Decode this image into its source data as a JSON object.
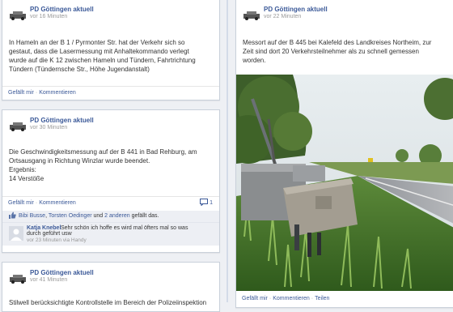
{
  "posts": [
    {
      "author": "PD Göttingen aktuell",
      "time": "vor 16 Minuten",
      "text": "In Hameln an der B 1 / Pyrmonter Str. hat der Verkehr sich so\ngestaut, dass die Lasermessung mit Anhaltekommando verlegt\nwurde auf die K 12 zwischen Hameln und Tündern, Fahrtrichtung\nTündern (Tündernsche Str., Höhe Jugendanstalt)",
      "like": "Gefällt mir",
      "comment": "Kommentieren"
    },
    {
      "author": "PD Göttingen aktuell",
      "time": "vor 30 Minuten",
      "text": "Die Geschwindigkeitsmessung auf der B 441 in Bad Rehburg, am\nOrtsausgang in Richtung Winzlar wurde beendet.\nErgebnis:\n14 Verstöße",
      "like": "Gefällt mir",
      "comment": "Kommentieren",
      "comment_count": "1",
      "likes": {
        "name1": "Bibi Busse",
        "name2": "Torsten Oedinger",
        "connector": "und",
        "others": "2 anderen",
        "suffix": "gefällt das."
      },
      "reply": {
        "author": "Katja Knebel",
        "text1": "Sehr schön ich hoffe es wird mal öfters mal so was",
        "text2": "durch geführt usw",
        "time": "vor 23 Minuten via Handy"
      }
    },
    {
      "author": "PD Göttingen aktuell",
      "time": "vor 41 Minuten",
      "text": "Stilwell berücksichtigte Kontrollstelle im Bereich der Polizeiinspektion"
    },
    {
      "author": "PD Göttingen aktuell",
      "time": "vor 22 Minuten",
      "text": "Messort auf der B 445 bei Kalefeld des Landkreises Northeim, zur\nZeit sind dort 20 Verkehrsteilnehmer als zu schnell gemessen\nworden.",
      "like": "Gefällt mir",
      "comment": "Kommentieren",
      "share": "Teilen"
    }
  ],
  "colors": {
    "link": "#3b5998",
    "meta": "#999999",
    "background": "#eef0f4"
  }
}
